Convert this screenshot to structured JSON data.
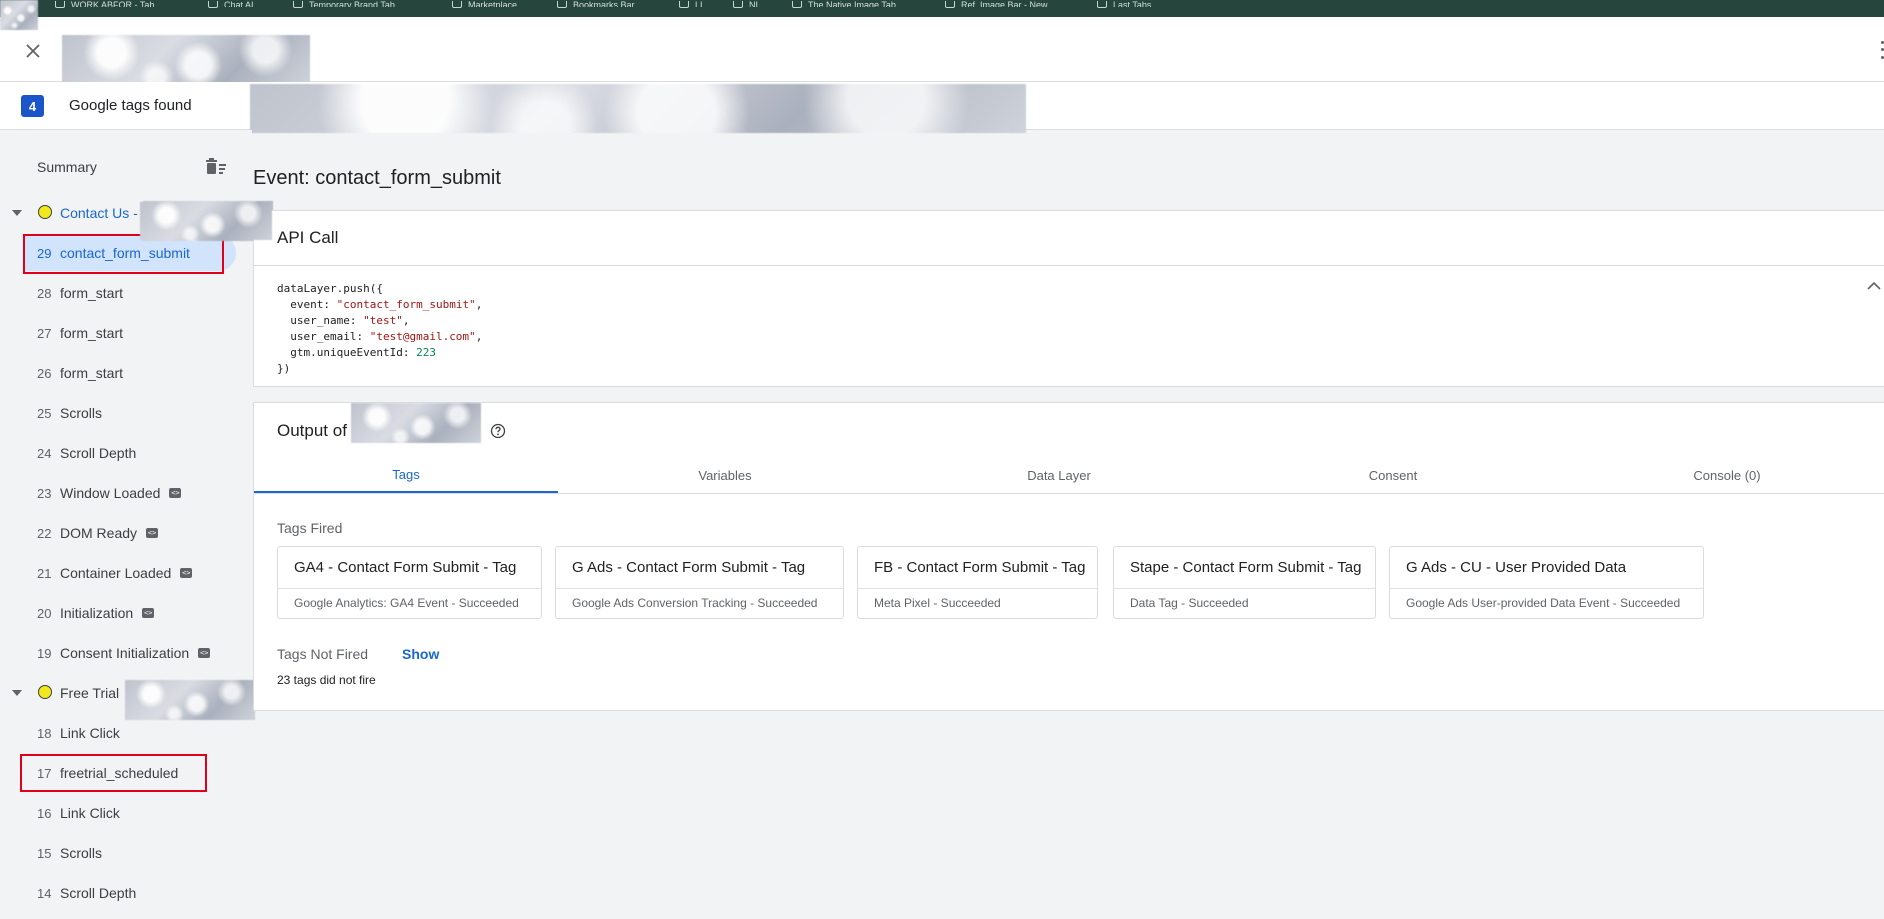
{
  "bookmarks": [
    {
      "label": "WORK ABFOR - Tab"
    },
    {
      "label": "Chat AI"
    },
    {
      "label": "Temporary Brand Tab"
    },
    {
      "label": "Marketplace"
    },
    {
      "label": "Bookmarks Bar"
    },
    {
      "label": "LI"
    },
    {
      "label": "NI"
    },
    {
      "label": "The Native Image Tab"
    },
    {
      "label": "Ref. Image Bar - New"
    },
    {
      "label": "Last Tabs"
    }
  ],
  "header": {
    "close_icon": "close-icon",
    "more_icon": "more-vert-icon"
  },
  "tags_bar": {
    "count": "4",
    "label": "Google tags found"
  },
  "sidebar": {
    "summary_label": "Summary",
    "clear_icon": "delete-sweep-icon",
    "groups": [
      {
        "label": "Contact Us -",
        "color": "#f3e81b",
        "events": [
          {
            "num": "29",
            "name": "contact_form_submit",
            "api": false,
            "selected": true
          },
          {
            "num": "28",
            "name": "form_start",
            "api": false
          },
          {
            "num": "27",
            "name": "form_start",
            "api": false
          },
          {
            "num": "26",
            "name": "form_start",
            "api": false
          },
          {
            "num": "25",
            "name": "Scrolls",
            "api": false
          },
          {
            "num": "24",
            "name": "Scroll Depth",
            "api": false
          },
          {
            "num": "23",
            "name": "Window Loaded",
            "api": true
          },
          {
            "num": "22",
            "name": "DOM Ready",
            "api": true
          },
          {
            "num": "21",
            "name": "Container Loaded",
            "api": true
          },
          {
            "num": "20",
            "name": "Initialization",
            "api": true
          },
          {
            "num": "19",
            "name": "Consent Initialization",
            "api": true
          }
        ]
      },
      {
        "label": "Free Trial",
        "color": "#f3e81b",
        "events": [
          {
            "num": "18",
            "name": "Link Click",
            "api": false
          },
          {
            "num": "17",
            "name": "freetrial_scheduled",
            "api": false
          },
          {
            "num": "16",
            "name": "Link Click",
            "api": false
          },
          {
            "num": "15",
            "name": "Scrolls",
            "api": false
          },
          {
            "num": "14",
            "name": "Scroll Depth",
            "api": false
          }
        ]
      }
    ],
    "api_badge": "<>"
  },
  "main": {
    "event_title": "Event: contact_form_submit",
    "api_call": {
      "title": "API Call",
      "code": {
        "open": "dataLayer.push({",
        "lines": [
          {
            "key": "  event: ",
            "value": "\"contact_form_submit\"",
            "type": "str",
            "comma": ","
          },
          {
            "key": "  user_name: ",
            "value": "\"test\"",
            "type": "str",
            "comma": ","
          },
          {
            "key": "  user_email: ",
            "value": "\"test@gmail.com\"",
            "type": "str",
            "comma": ","
          },
          {
            "key": "  gtm.uniqueEventId: ",
            "value": "223",
            "type": "num",
            "comma": ""
          }
        ],
        "close": "})"
      }
    },
    "output": {
      "title": "Output of",
      "help_icon": "help-icon",
      "tabs": [
        "Tags",
        "Variables",
        "Data Layer",
        "Consent",
        "Console (0)"
      ],
      "active_tab": 0,
      "tags_fired_label": "Tags Fired",
      "tags_fired": [
        {
          "name": "GA4 - Contact Form Submit - Tag",
          "status": "Google Analytics: GA4 Event - Succeeded"
        },
        {
          "name": "G Ads - Contact Form Submit - Tag",
          "status": "Google Ads Conversion Tracking - Succeeded"
        },
        {
          "name": "FB - Contact Form Submit - Tag",
          "status": "Meta Pixel - Succeeded"
        },
        {
          "name": "Stape - Contact Form Submit - Tag",
          "status": "Data Tag - Succeeded"
        },
        {
          "name": "G Ads - CU - User Provided Data",
          "status": "Google Ads User-provided Data Event - Succeeded"
        }
      ],
      "tags_not_fired_label": "Tags Not Fired",
      "show_label": "Show",
      "did_not_fire_text": "23 tags did not fire"
    }
  }
}
